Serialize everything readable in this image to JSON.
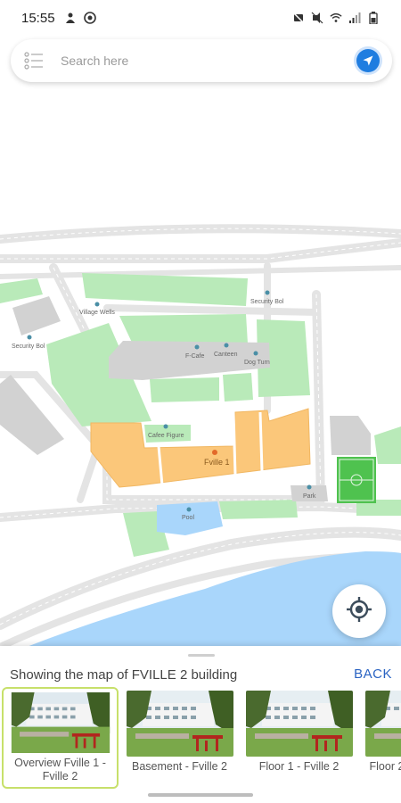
{
  "status_bar": {
    "time": "15:55",
    "left_icons": [
      "alarm-person-icon",
      "settings-sync-icon"
    ],
    "right_icons": [
      "mute-icon",
      "vibrate-off-icon",
      "wifi-icon",
      "signal-icon",
      "battery-icon"
    ]
  },
  "search": {
    "placeholder": "Search here",
    "menu_icon": "list-menu-icon",
    "nav_icon": "navigation-arrow-icon"
  },
  "map": {
    "labels": {
      "security_1": "Security Bol",
      "village_wells": "Village Wells",
      "security_2": "Security Bol",
      "f_cafe": "F-Cafe",
      "canteen": "Canteen",
      "dog_turn": "Dog Turn",
      "cafe_figure": "Cafee Figure",
      "fville_1": "Fville 1",
      "pool": "Pool",
      "park": "Park"
    },
    "colors": {
      "road": "#e7e7e7",
      "green": "#b9eab9",
      "building": "#d3d3d3",
      "highlight": "#fbc77a",
      "water": "#a9d6fb",
      "football": "#4fc24f"
    }
  },
  "locate_icon": "my-location-icon",
  "bottom_sheet": {
    "title": "Showing the map of FVILLE 2 building",
    "back_label": "BACK",
    "floors": [
      {
        "label": "Overview Fville 1 - Fville 2",
        "selected": true
      },
      {
        "label": "Basement - Fville 2",
        "selected": false
      },
      {
        "label": "Floor 1 - Fville 2",
        "selected": false
      },
      {
        "label": "Floor 2",
        "selected": false
      }
    ]
  }
}
